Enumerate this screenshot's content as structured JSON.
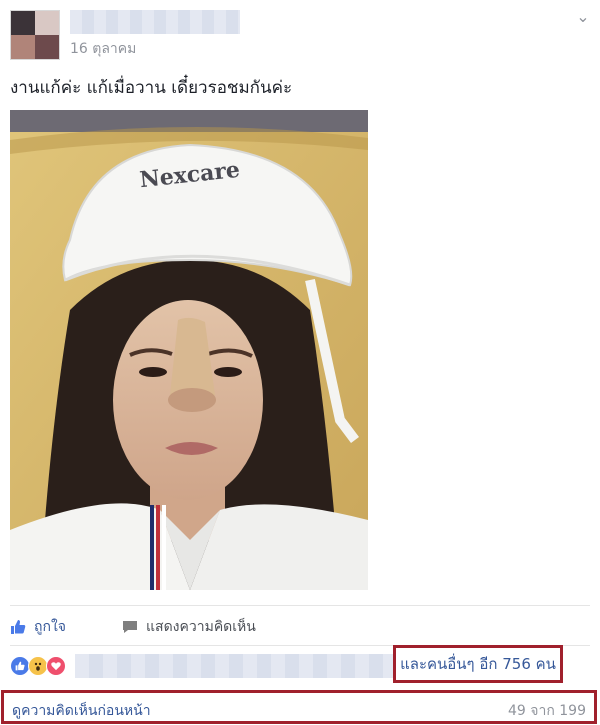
{
  "post": {
    "date": "16 ตุลาคม",
    "caption": "งานแก้ค่ะ แก้เมื่อวาน เดี๋ยวรอชมกันค่ะ",
    "photo": {
      "cap_text": "Nexcare"
    }
  },
  "actions": {
    "like_label": "ถูกใจ",
    "comment_label": "แสดงความคิดเห็น"
  },
  "reactions": {
    "icons": [
      "like-icon",
      "wow-icon",
      "love-icon"
    ],
    "others_text": "และคนอื่นๆ อีก 756 คน"
  },
  "comments": {
    "view_previous": "ดูความคิดเห็นก่อนหน้า",
    "count": "49 จาก 199"
  },
  "colors": {
    "link": "#365899",
    "highlight_border": "#a0202c",
    "meta": "#90949c"
  }
}
